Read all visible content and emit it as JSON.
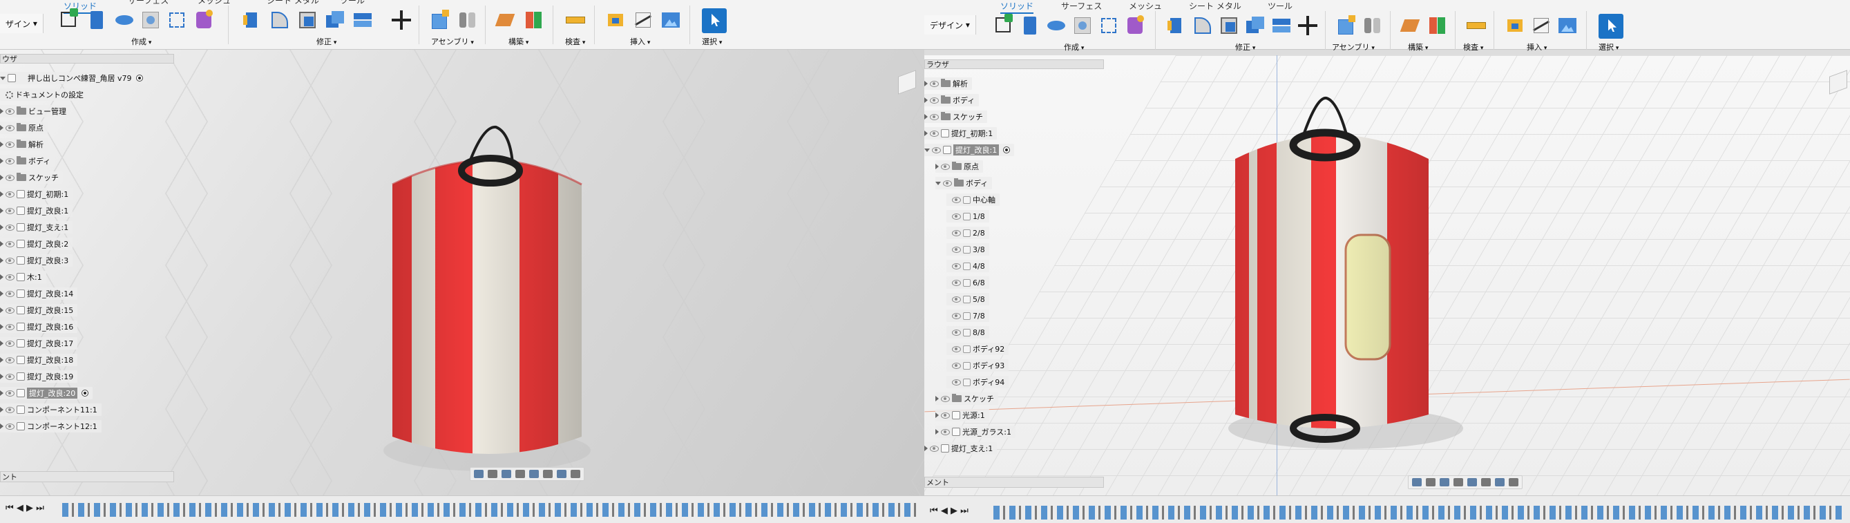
{
  "left": {
    "toolbar": {
      "workspace": "ザイン",
      "tabs": [
        "ソリッド",
        "サーフェス",
        "メッシュ",
        "シート メタル",
        "ツール"
      ],
      "groups": [
        "作成",
        "修正",
        "アセンブリ",
        "構築",
        "検査",
        "挿入",
        "選択"
      ]
    },
    "browser": {
      "header": "ウザ",
      "document": "押し出しコンペ練習_角居 v79",
      "items": [
        {
          "label": "ドキュメントの設定",
          "icon": "gear-icon"
        },
        {
          "label": "ビュー管理",
          "icon": "folder-icon"
        },
        {
          "label": "原点",
          "icon": "folder-icon"
        },
        {
          "label": "解析",
          "icon": "folder-icon"
        },
        {
          "label": "ボディ",
          "icon": "folder-icon"
        },
        {
          "label": "スケッチ",
          "icon": "folder-icon"
        },
        {
          "label": "提灯_初期:1",
          "icon": "component-icon"
        },
        {
          "label": "提灯_改良:1",
          "icon": "component-icon"
        },
        {
          "label": "提灯_支え:1",
          "icon": "component-icon"
        },
        {
          "label": "提灯_改良:2",
          "icon": "component-icon"
        },
        {
          "label": "提灯_改良:3",
          "icon": "component-icon"
        },
        {
          "label": "木:1",
          "icon": "component-icon"
        },
        {
          "label": "提灯_改良:14",
          "icon": "component-icon"
        },
        {
          "label": "提灯_改良:15",
          "icon": "component-icon"
        },
        {
          "label": "提灯_改良:16",
          "icon": "component-icon"
        },
        {
          "label": "提灯_改良:17",
          "icon": "component-icon"
        },
        {
          "label": "提灯_改良:18",
          "icon": "component-icon"
        },
        {
          "label": "提灯_改良:19",
          "icon": "component-icon"
        },
        {
          "label": "提灯_改良:20",
          "icon": "component-icon",
          "selected": true
        },
        {
          "label": "コンポーネント11:1",
          "icon": "component-icon"
        },
        {
          "label": "コンポーネント12:1",
          "icon": "component-icon"
        }
      ]
    },
    "comment": "ント"
  },
  "right": {
    "toolbar": {
      "workspace": "デザイン",
      "tabs": [
        "ソリッド",
        "サーフェス",
        "メッシュ",
        "シート メタル",
        "ツール"
      ],
      "groups": [
        "作成",
        "修正",
        "アセンブリ",
        "構築",
        "検査",
        "挿入",
        "選択"
      ]
    },
    "browser": {
      "header": "ラウザ",
      "items": [
        {
          "label": "解析",
          "icon": "folder-icon",
          "level": 0
        },
        {
          "label": "ボディ",
          "icon": "folder-icon",
          "level": 0
        },
        {
          "label": "スケッチ",
          "icon": "folder-icon",
          "level": 0
        },
        {
          "label": "提灯_初期:1",
          "icon": "component-icon",
          "level": 0
        },
        {
          "label": "提灯_改良:1",
          "icon": "component-icon",
          "level": 0,
          "selected": true,
          "open": true
        },
        {
          "label": "原点",
          "icon": "folder-icon",
          "level": 1
        },
        {
          "label": "ボディ",
          "icon": "folder-icon",
          "level": 1,
          "open": true
        },
        {
          "label": "中心軸",
          "icon": "body-icon",
          "level": 2
        },
        {
          "label": "1/8",
          "icon": "body-icon",
          "level": 2
        },
        {
          "label": "2/8",
          "icon": "body-icon",
          "level": 2
        },
        {
          "label": "3/8",
          "icon": "body-icon",
          "level": 2
        },
        {
          "label": "4/8",
          "icon": "body-icon",
          "level": 2
        },
        {
          "label": "6/8",
          "icon": "body-icon",
          "level": 2
        },
        {
          "label": "5/8",
          "icon": "body-icon",
          "level": 2
        },
        {
          "label": "7/8",
          "icon": "body-icon",
          "level": 2
        },
        {
          "label": "8/8",
          "icon": "body-icon",
          "level": 2
        },
        {
          "label": "ボディ92",
          "icon": "body-icon",
          "level": 2
        },
        {
          "label": "ボディ93",
          "icon": "body-icon",
          "level": 2
        },
        {
          "label": "ボディ94",
          "icon": "body-icon",
          "level": 2
        },
        {
          "label": "スケッチ",
          "icon": "folder-icon",
          "level": 1
        },
        {
          "label": "光源:1",
          "icon": "component-icon",
          "level": 1
        },
        {
          "label": "光源_ガラス:1",
          "icon": "component-icon",
          "level": 1
        },
        {
          "label": "提灯_支え:1",
          "icon": "component-icon",
          "level": 0
        }
      ]
    },
    "comment": "メント"
  },
  "colors": {
    "accent": "#1b73c6",
    "lantern_red": "#f23a3a",
    "lantern_white": "#ece8de",
    "handle": "#1e1e1e",
    "light_yellow": "#f4f2b8"
  }
}
